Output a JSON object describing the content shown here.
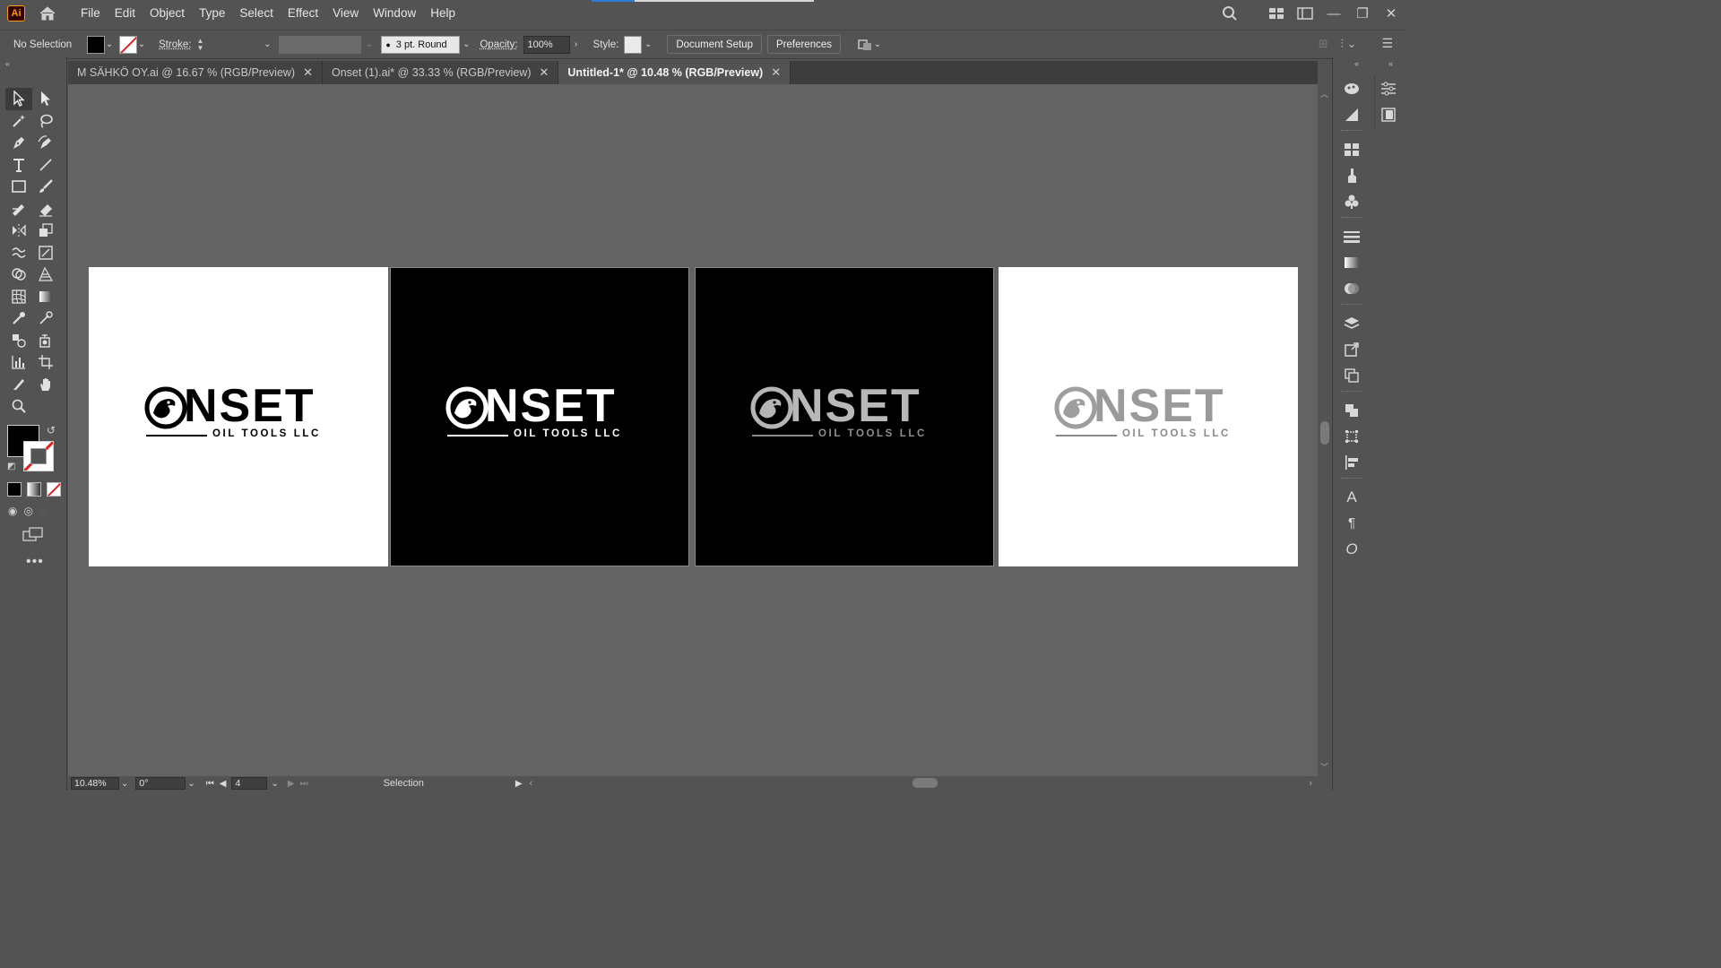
{
  "app": {
    "logo_text": "Ai"
  },
  "menu": [
    "File",
    "Edit",
    "Object",
    "Type",
    "Select",
    "Effect",
    "View",
    "Window",
    "Help"
  ],
  "control_bar": {
    "selection_status": "No Selection",
    "stroke_label": "Stroke:",
    "brush_value": "3 pt. Round",
    "opacity_label": "Opacity:",
    "opacity_value": "100%",
    "style_label": "Style:",
    "document_setup": "Document Setup",
    "preferences": "Preferences"
  },
  "tabs": [
    {
      "label": "M SÄHKÖ OY.ai @ 16.67 % (RGB/Preview)",
      "active": false
    },
    {
      "label": "Onset (1).ai* @ 33.33 % (RGB/Preview)",
      "active": false
    },
    {
      "label": "Untitled-1* @ 10.48 % (RGB/Preview)",
      "active": true
    }
  ],
  "artboards": [
    {
      "background": "#ffffff",
      "logo_color": "#000000",
      "variant": "black-on-white"
    },
    {
      "background": "#000000",
      "logo_color": "#ffffff",
      "variant": "white-on-black"
    },
    {
      "background": "#000000",
      "logo_color": "#b8b8b8",
      "variant": "silver-on-black"
    },
    {
      "background": "#ffffff",
      "logo_color": "#9a9a9a",
      "variant": "silver-on-white"
    }
  ],
  "logo": {
    "word": "NSET",
    "subtitle": "OIL TOOLS LLC"
  },
  "statusbar": {
    "zoom": "10.48%",
    "rotation": "0°",
    "artboard_number": "4",
    "tool_status": "Selection"
  },
  "colors": {
    "ui_bg": "#535353",
    "canvas_bg": "#636363",
    "accent": "#2d7bd5",
    "app_orange": "#ff9a00"
  }
}
